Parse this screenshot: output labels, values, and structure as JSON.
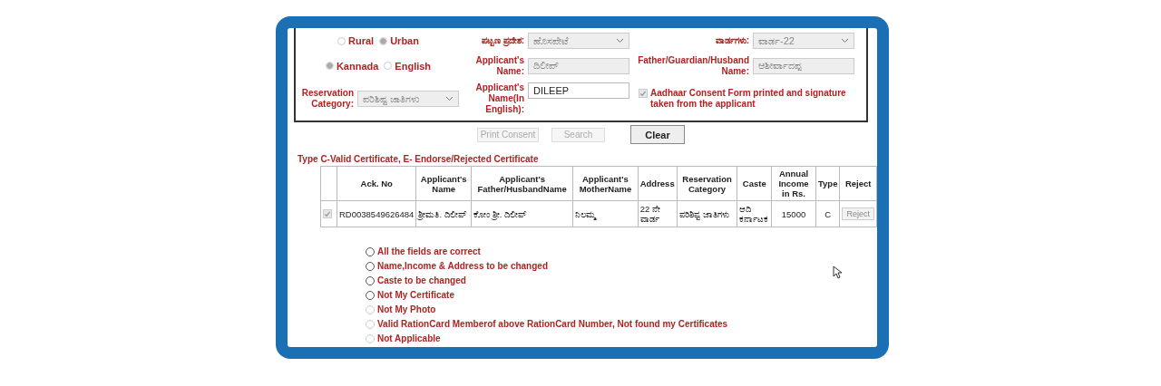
{
  "form": {
    "location_radios": [
      {
        "label": "Rural",
        "selected": false,
        "disabled": true
      },
      {
        "label": "Urban",
        "selected": true,
        "disabled": true
      }
    ],
    "town": {
      "label": "ಪಟ್ಟಣ ಪ್ರದೇಶ:",
      "value": "ಹೊಸಪೇಟೆ",
      "disabled": true
    },
    "ward": {
      "label": "ವಾರ್ಡಗಳು:",
      "value": "ವಾರ್ಡ-22",
      "disabled": true
    },
    "language_radios": [
      {
        "label": "Kannada",
        "selected": true,
        "disabled": true
      },
      {
        "label": "English",
        "selected": false,
        "disabled": true
      }
    ],
    "applicant_name": {
      "label": "Applicant's Name:",
      "value": "ದಿಲೀಪ್",
      "disabled": true
    },
    "father_name": {
      "label": "Father/Guardian/Husband Name:",
      "value": "ಆಶೀರ್ವಾದಪ್ಪ",
      "disabled": true
    },
    "reservation": {
      "label": "Reservation Category:",
      "value": "ಪರಿಶಿಷ್ಟ ಜಾತಿಗಳು",
      "disabled": true
    },
    "applicant_name_en": {
      "label": "Applicant's Name(In English):",
      "value": "DILEEP",
      "disabled": false
    },
    "aadhaar_consent": {
      "label": "Aadhaar Consent Form printed and signature taken from the applicant",
      "checked": true,
      "disabled": true
    }
  },
  "buttons": [
    {
      "label": "Print Consent",
      "disabled": true
    },
    {
      "label": "Search",
      "disabled": true
    },
    {
      "label": "Clear",
      "disabled": false
    }
  ],
  "legend": "Type C-Valid Certificate, E- Endorse/Rejected Certificate",
  "table": {
    "columns": [
      "Ack. No",
      "Applicant's Name",
      "Applicant's Father/HusbandName",
      "Applicant's MotherName",
      "Address",
      "Reservation Category",
      "Caste",
      "Annual Income in Rs.",
      "Type",
      "Reject"
    ],
    "rows": [
      {
        "checked": true,
        "cells": [
          "RD0038549626484",
          "ಶ್ರೀಮತಿ. ದಿಲೀಪ್",
          "ಕೋಂ ಶ್ರೀ. ದಿಲೀಪ್",
          "ನಿಲಮ್ಮ",
          "22 ನೇ ವಾರ್ಡ",
          "ಪರಿಶಿಷ್ಟ ಜಾತಿಗಳು",
          "ಆದಿ ಕರ್ನಾಟಕ",
          "15000",
          "C"
        ],
        "reject": {
          "label": "Reject",
          "disabled": true
        }
      }
    ]
  },
  "options": [
    {
      "label": "All the fields are correct",
      "selected": false,
      "disabled": false
    },
    {
      "label": "Name,Income & Address to be changed",
      "selected": false,
      "disabled": false
    },
    {
      "label": "Caste to be changed",
      "selected": false,
      "disabled": false
    },
    {
      "label": "Not My Certificate",
      "selected": false,
      "disabled": false
    },
    {
      "label": "Not My Photo",
      "selected": false,
      "disabled": true
    },
    {
      "label": "Valid RationCard Memberof above RationCard Number, Not found my Certificates",
      "selected": false,
      "disabled": true
    },
    {
      "label": "Not Applicable",
      "selected": false,
      "disabled": true
    }
  ]
}
